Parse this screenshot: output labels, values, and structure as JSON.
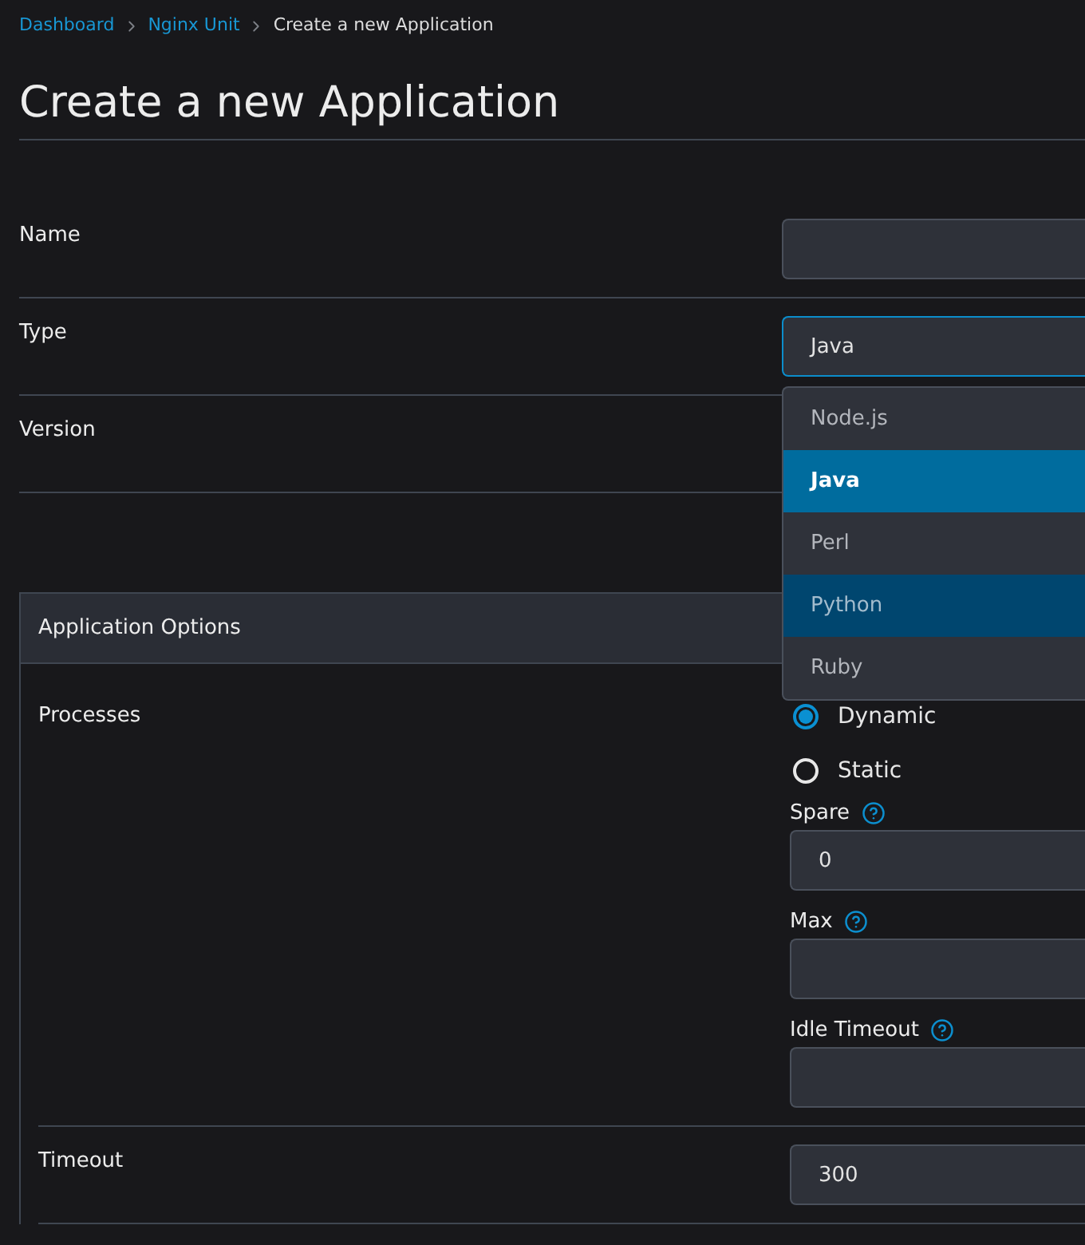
{
  "breadcrumb": [
    {
      "label": "Dashboard",
      "kind": "link"
    },
    {
      "label": "Nginx Unit",
      "kind": "link"
    },
    {
      "label": "Create a new Application",
      "kind": "current"
    }
  ],
  "title": "Create a new Application",
  "fields": [
    {
      "label": "Name",
      "kind": "input",
      "focused": false
    },
    {
      "label": "Type",
      "kind": "select",
      "value": "Java",
      "focused": true,
      "options": [
        {
          "label": "Node.js",
          "selected": false,
          "hovered": false
        },
        {
          "label": "Java",
          "selected": true,
          "hovered": false
        },
        {
          "label": "Perl",
          "selected": false,
          "hovered": false
        },
        {
          "label": "Python",
          "selected": false,
          "hovered": true
        },
        {
          "label": "Ruby",
          "selected": false,
          "hovered": false
        }
      ]
    },
    {
      "label": "Version",
      "kind": "covered"
    }
  ],
  "application_options": {
    "title": "Application Options",
    "rows": [
      {
        "label": "Processes",
        "kind": "processes",
        "modes": [
          {
            "label": "Dynamic",
            "selected": true
          },
          {
            "label": "Static",
            "selected": false
          }
        ],
        "fields": [
          {
            "label": "Spare",
            "value": "0",
            "help": true
          },
          {
            "label": "Max",
            "help": true
          },
          {
            "label": "Idle Timeout",
            "help": true
          }
        ]
      },
      {
        "label": "Timeout",
        "kind": "input",
        "value": "300"
      }
    ]
  }
}
